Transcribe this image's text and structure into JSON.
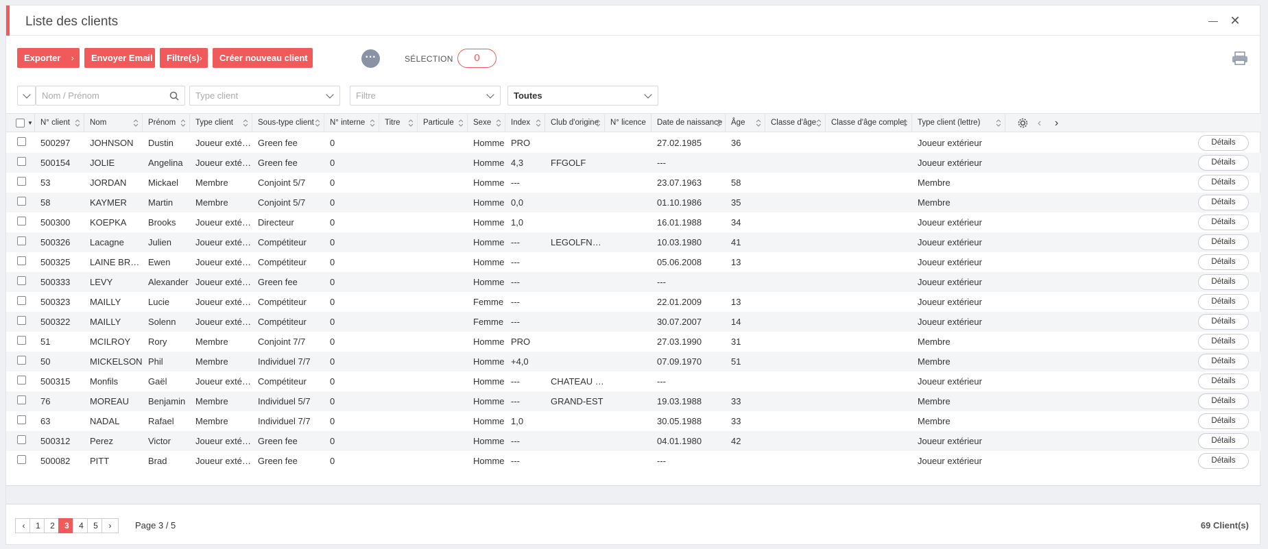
{
  "window": {
    "title": "Liste des clients",
    "minimize_glyph": "—",
    "close_glyph": "✕"
  },
  "toolbar": {
    "export_label": "Exporter",
    "email_label": "Envoyer Email",
    "filters_label": "Filtre(s)",
    "create_label": "Créer nouveau client",
    "more_glyph": "···",
    "selection_label": "SÉLECTION",
    "selection_count": "0",
    "print_icon": "printer-icon"
  },
  "filters": {
    "name_placeholder": "Nom / Prénom",
    "type_placeholder": "Type client",
    "filter_placeholder": "Filtre",
    "scope_value": "Toutes"
  },
  "table": {
    "columns": [
      "N° client",
      "Nom",
      "Prénom",
      "Type client",
      "Sous-type client",
      "N° interne",
      "Titre",
      "Particule",
      "Sexe",
      "Index",
      "Club d'origine",
      "N° licence",
      "Date de naissance",
      "Âge",
      "Classe d'âge",
      "Classe d'âge complet",
      "Type client (lettre)"
    ],
    "details_label": "Détails",
    "rows": [
      {
        "num": "500297",
        "nom": "JOHNSON",
        "prenom": "Dustin",
        "type": "Joueur extérieur",
        "sous": "Green fee",
        "interne": "0",
        "sexe": "Homme",
        "index": "PRO",
        "club": "",
        "naiss": "27.02.1985",
        "age": "36",
        "lettre": "Joueur extérieur"
      },
      {
        "num": "500154",
        "nom": "JOLIE",
        "prenom": "Angelina",
        "type": "Joueur extérieur",
        "sous": "Green fee",
        "interne": "0",
        "sexe": "Homme",
        "index": "4,3",
        "club": "FFGOLF",
        "naiss": "---",
        "age": "",
        "lettre": "Joueur extérieur"
      },
      {
        "num": "53",
        "nom": "JORDAN",
        "prenom": "Mickael",
        "type": "Membre",
        "sous": "Conjoint 5/7",
        "interne": "0",
        "sexe": "Homme",
        "index": "---",
        "club": "",
        "naiss": "23.07.1963",
        "age": "58",
        "lettre": "Membre"
      },
      {
        "num": "58",
        "nom": "KAYMER",
        "prenom": "Martin",
        "type": "Membre",
        "sous": "Conjoint 5/7",
        "interne": "0",
        "sexe": "Homme",
        "index": "0,0",
        "club": "",
        "naiss": "01.10.1986",
        "age": "35",
        "lettre": "Membre"
      },
      {
        "num": "500300",
        "nom": "KOEPKA",
        "prenom": "Brooks",
        "type": "Joueur extérieur",
        "sous": "Directeur",
        "interne": "0",
        "sexe": "Homme",
        "index": "1,0",
        "club": "",
        "naiss": "16.01.1988",
        "age": "34",
        "lettre": "Joueur extérieur"
      },
      {
        "num": "500326",
        "nom": "Lacagne",
        "prenom": "Julien",
        "type": "Joueur extérieur",
        "sous": "Compétiteur",
        "interne": "0",
        "sexe": "Homme",
        "index": "---",
        "club": "LEGOLFNATIONAL",
        "naiss": "10.03.1980",
        "age": "41",
        "lettre": "Joueur extérieur"
      },
      {
        "num": "500325",
        "nom": "LAINE BRUNEL",
        "prenom": "Ewen",
        "type": "Joueur extérieur",
        "sous": "Compétiteur",
        "interne": "0",
        "sexe": "Homme",
        "index": "---",
        "club": "",
        "naiss": "05.06.2008",
        "age": "13",
        "lettre": "Joueur extérieur"
      },
      {
        "num": "500333",
        "nom": "LEVY",
        "prenom": "Alexander",
        "type": "Joueur extérieur",
        "sous": "Green fee",
        "interne": "0",
        "sexe": "Homme",
        "index": "---",
        "club": "",
        "naiss": "---",
        "age": "",
        "lettre": "Joueur extérieur"
      },
      {
        "num": "500323",
        "nom": "MAILLY",
        "prenom": "Lucie",
        "type": "Joueur extérieur",
        "sous": "Compétiteur",
        "interne": "0",
        "sexe": "Femme",
        "index": "---",
        "club": "",
        "naiss": "22.01.2009",
        "age": "13",
        "lettre": "Joueur extérieur"
      },
      {
        "num": "500322",
        "nom": "MAILLY",
        "prenom": "Solenn",
        "type": "Joueur extérieur",
        "sous": "Compétiteur",
        "interne": "0",
        "sexe": "Femme",
        "index": "---",
        "club": "",
        "naiss": "30.07.2007",
        "age": "14",
        "lettre": "Joueur extérieur"
      },
      {
        "num": "51",
        "nom": "MCILROY",
        "prenom": "Rory",
        "type": "Membre",
        "sous": "Conjoint 7/7",
        "interne": "0",
        "sexe": "Homme",
        "index": "PRO",
        "club": "",
        "naiss": "27.03.1990",
        "age": "31",
        "lettre": "Membre"
      },
      {
        "num": "50",
        "nom": "MICKELSON",
        "prenom": "Phil",
        "type": "Membre",
        "sous": "Individuel 7/7",
        "interne": "0",
        "sexe": "Homme",
        "index": "+4,0",
        "club": "",
        "naiss": "07.09.1970",
        "age": "51",
        "lettre": "Membre"
      },
      {
        "num": "500315",
        "nom": "Monfils",
        "prenom": "Gaël",
        "type": "Joueur extérieur",
        "sous": "Compétiteur",
        "interne": "0",
        "sexe": "Homme",
        "index": "---",
        "club": "CHATEAU DU BREUIL",
        "naiss": "---",
        "age": "",
        "lettre": "Joueur extérieur"
      },
      {
        "num": "76",
        "nom": "MOREAU",
        "prenom": "Benjamin",
        "type": "Membre",
        "sous": "Individuel 5/7",
        "interne": "0",
        "sexe": "Homme",
        "index": "---",
        "club": "GRAND-EST",
        "naiss": "19.03.1988",
        "age": "33",
        "lettre": "Membre"
      },
      {
        "num": "63",
        "nom": "NADAL",
        "prenom": "Rafael",
        "type": "Membre",
        "sous": "Individuel 7/7",
        "interne": "0",
        "sexe": "Homme",
        "index": "1,0",
        "club": "",
        "naiss": "30.05.1988",
        "age": "33",
        "lettre": "Membre"
      },
      {
        "num": "500312",
        "nom": "Perez",
        "prenom": "Victor",
        "type": "Joueur extérieur",
        "sous": "Green fee",
        "interne": "0",
        "sexe": "Homme",
        "index": "---",
        "club": "",
        "naiss": "04.01.1980",
        "age": "42",
        "lettre": "Joueur extérieur"
      },
      {
        "num": "500082",
        "nom": "PITT",
        "prenom": "Brad",
        "type": "Joueur extérieur",
        "sous": "Green fee",
        "interne": "0",
        "sexe": "Homme",
        "index": "---",
        "club": "",
        "naiss": "---",
        "age": "",
        "lettre": "Joueur extérieur"
      }
    ]
  },
  "pagination": {
    "prev_glyph": "‹",
    "next_glyph": "›",
    "pages": [
      "1",
      "2",
      "3",
      "4",
      "5"
    ],
    "current": "3",
    "page_info": "Page 3 / 5",
    "total": "69 Client(s)"
  },
  "colors": {
    "accent": "#f05a5b",
    "more": "#8a93a6"
  }
}
